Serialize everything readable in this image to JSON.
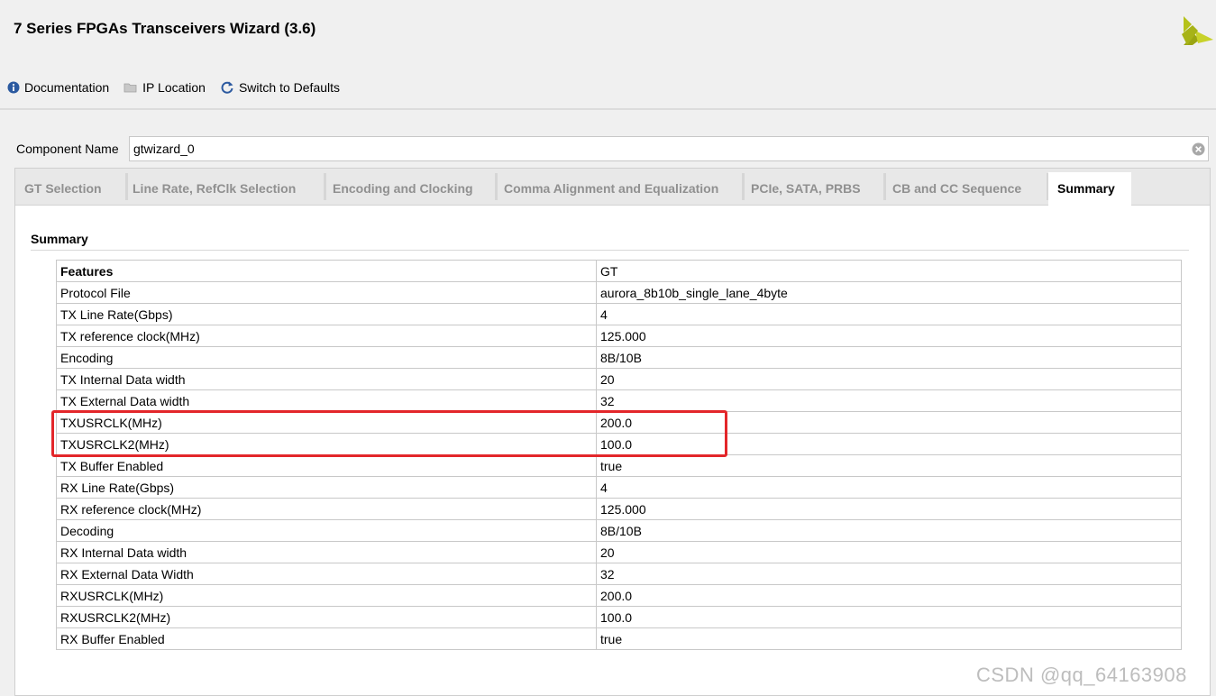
{
  "window": {
    "title": "7 Series FPGAs Transceivers Wizard (3.6)",
    "logo_icon": "xilinx-logo-icon"
  },
  "toolbar": {
    "documentation": "Documentation",
    "ip_location": "IP Location",
    "switch_defaults": "Switch to Defaults"
  },
  "component": {
    "label": "Component Name",
    "value": "gtwizard_0"
  },
  "tabs": [
    {
      "label": "GT Selection"
    },
    {
      "label": "Line Rate, RefClk Selection"
    },
    {
      "label": "Encoding and Clocking"
    },
    {
      "label": "Comma Alignment and Equalization"
    },
    {
      "label": "PCIe, SATA, PRBS"
    },
    {
      "label": "CB and CC Sequence"
    },
    {
      "label": "Summary"
    }
  ],
  "active_tab": "Summary",
  "summary": {
    "title": "Summary",
    "rows": [
      {
        "feature": "Features",
        "value": "GT"
      },
      {
        "feature": "Protocol File",
        "value": "aurora_8b10b_single_lane_4byte"
      },
      {
        "feature": "TX Line Rate(Gbps)",
        "value": "4"
      },
      {
        "feature": "TX reference clock(MHz)",
        "value": "125.000"
      },
      {
        "feature": "Encoding",
        "value": "8B/10B"
      },
      {
        "feature": "TX Internal Data width",
        "value": "20"
      },
      {
        "feature": "TX External Data width",
        "value": "32"
      },
      {
        "feature": "TXUSRCLK(MHz)",
        "value": "200.0"
      },
      {
        "feature": "TXUSRCLK2(MHz)",
        "value": "100.0"
      },
      {
        "feature": "TX Buffer Enabled",
        "value": "true"
      },
      {
        "feature": "RX Line Rate(Gbps)",
        "value": "4"
      },
      {
        "feature": "RX reference clock(MHz)",
        "value": "125.000"
      },
      {
        "feature": "Decoding",
        "value": "8B/10B"
      },
      {
        "feature": "RX Internal Data width",
        "value": "20"
      },
      {
        "feature": "RX External Data Width",
        "value": "32"
      },
      {
        "feature": "RXUSRCLK(MHz)",
        "value": "200.0"
      },
      {
        "feature": "RXUSRCLK2(MHz)",
        "value": "100.0"
      },
      {
        "feature": "RX Buffer Enabled",
        "value": "true"
      }
    ]
  },
  "watermark": "CSDN @qq_64163908",
  "colors": {
    "highlight": "#e3262a",
    "logo": "#b5c21a"
  }
}
